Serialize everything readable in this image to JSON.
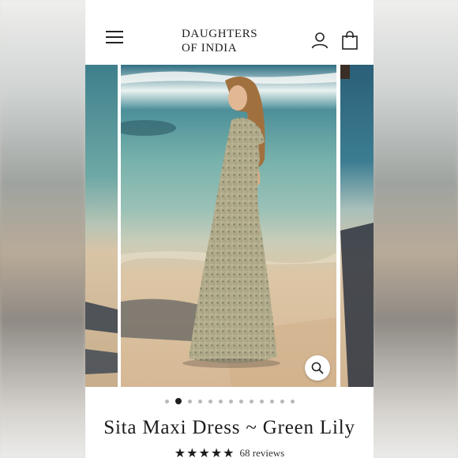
{
  "header": {
    "brand_line1": "DAUGHTERS",
    "brand_line2": "OF INDIA",
    "menu_icon": "hamburger-menu-icon",
    "account_icon": "user-icon",
    "cart_icon": "shopping-bag-icon"
  },
  "gallery": {
    "zoom_icon": "magnifier-icon",
    "slide_count": 13,
    "active_index": 1
  },
  "product": {
    "title": "Sita Maxi Dress ~ Green Lily",
    "star_count": 5,
    "stars": "★★★★★",
    "reviews_label": "68 reviews"
  },
  "colors": {
    "text": "#1b1b1b",
    "dot_inactive": "#b9b9b9",
    "dot_active": "#1f1f1f",
    "background": "#ffffff"
  }
}
